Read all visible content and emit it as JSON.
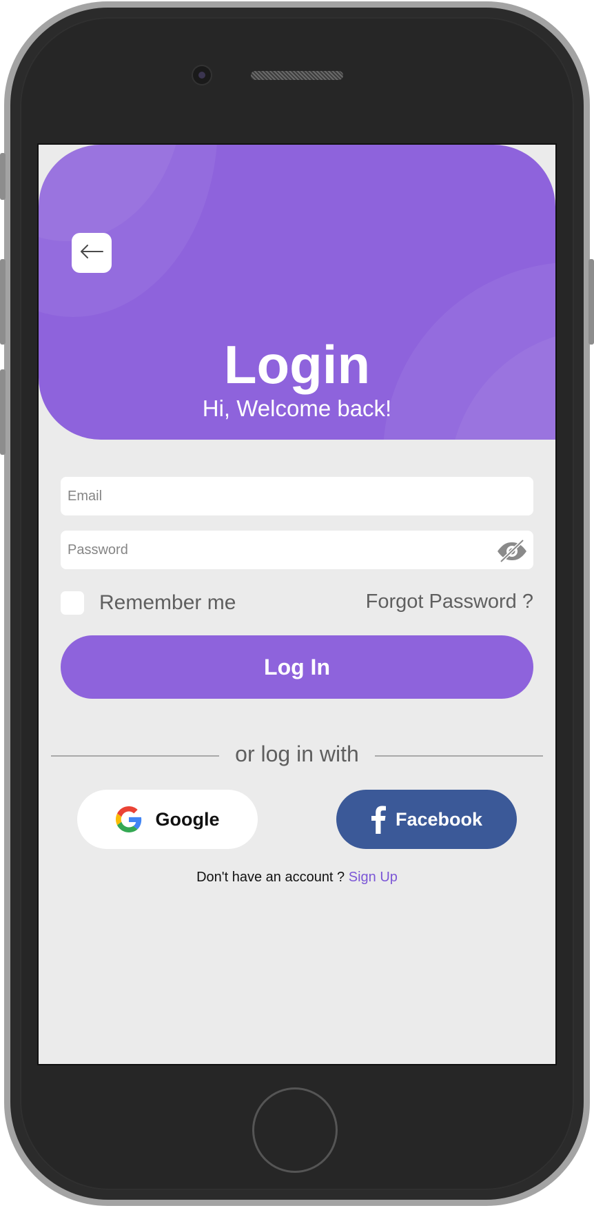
{
  "header": {
    "title": "Login",
    "subtitle": "Hi, Welcome back!",
    "back_icon": "arrow-left-icon"
  },
  "form": {
    "email_placeholder": "Email",
    "password_placeholder": "Password",
    "password_toggle_icon": "eye-off-icon",
    "remember_label": "Remember me",
    "forgot_label": "Forgot Password ?",
    "login_label": "Log In"
  },
  "social": {
    "divider_text": "or log in with",
    "google_label": "Google",
    "facebook_label": "Facebook"
  },
  "footer": {
    "no_account_text": "Don't have an account ? ",
    "signup_label": "Sign Up"
  },
  "colors": {
    "primary": "#8e63dc",
    "background": "#ebebeb",
    "facebook": "#3b5998",
    "link": "#7b56d6"
  }
}
